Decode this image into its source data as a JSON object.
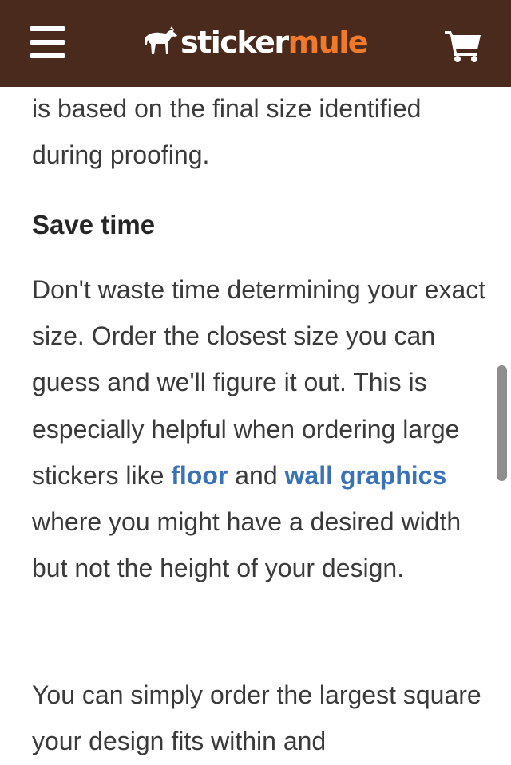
{
  "header": {
    "logo_text_light": "sticker",
    "logo_text_accent": "mule",
    "colors": {
      "background": "#4a2a1c",
      "logo_accent": "#f07a2a",
      "logo_light": "#ffffff"
    },
    "icons": {
      "menu": "hamburger-menu-icon",
      "logo": "mule-logo-icon",
      "cart": "shopping-cart-icon"
    }
  },
  "content": {
    "intro_text": "is based on the final size identified during proofing.",
    "section_heading": "Save time",
    "section_text_1": "Don't waste time determining your exact size. Order the closest size you can guess and we'll figure it out. This is especially helpful when ordering large stickers like",
    "link_floor": "floor",
    "text_and": "and",
    "link_wall_graphics": "wall graphics",
    "section_text_2": "where you might have a desired width but not the height of your design.",
    "closing_text": "You can simply order the largest square your design fits within and",
    "link_color": "#3a73b5"
  }
}
